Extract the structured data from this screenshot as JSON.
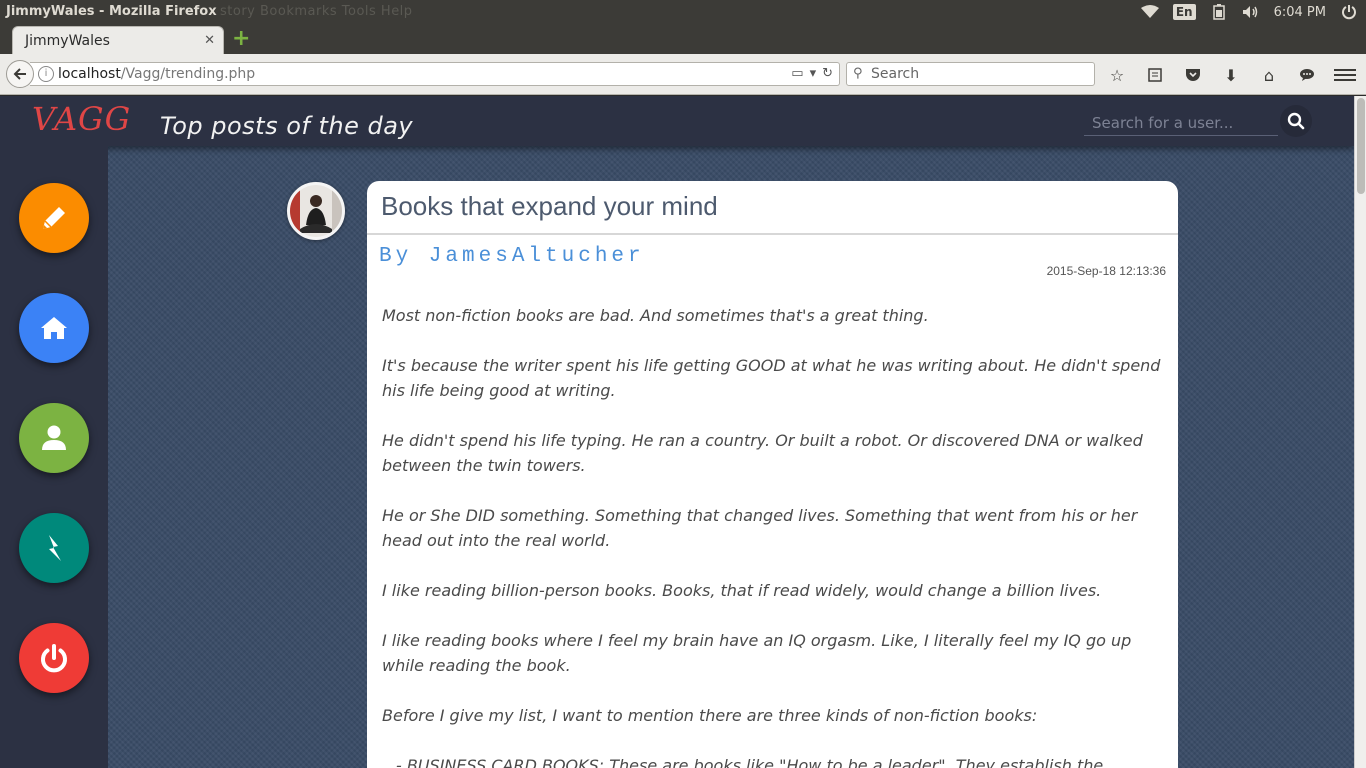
{
  "os": {
    "window_title": "JimmyWales - Mozilla Firefox",
    "ghost_menu": "story  Bookmarks  Tools  Help",
    "lang": "En",
    "clock": "6:04 PM"
  },
  "browser": {
    "tab_label": "JimmyWales",
    "url_host": "localhost",
    "url_path": "/Vagg/trending.php",
    "search_placeholder": "Search"
  },
  "app": {
    "brand": "VAGG",
    "heading": "Top posts of the day",
    "user_search_placeholder": "Search for a user...",
    "accent": "#e04646"
  },
  "sidebar": {
    "buttons": [
      {
        "name": "compose",
        "color": "#fb8c00"
      },
      {
        "name": "home",
        "color": "#3b82f6"
      },
      {
        "name": "profile",
        "color": "#7cb342"
      },
      {
        "name": "trending",
        "color": "#00897b"
      },
      {
        "name": "logout",
        "color": "#ef3b36"
      }
    ]
  },
  "post": {
    "title": "Books that expand your mind",
    "author": "By JamesAltucher",
    "date": "2015-Sep-18 12:13:36",
    "paragraphs": [
      "Most non-fiction books are bad. And sometimes that's a great thing.",
      "It's because the writer spent his life getting GOOD at what he was writing about. He didn't spend his life being good at writing.",
      "He didn't spend his life typing. He ran a country. Or built a robot. Or discovered DNA or walked between the twin towers.",
      "He or She DID something. Something that changed lives. Something that went from his or her head out into the real world.",
      "I like reading billion-person books. Books, that if read widely, would change a billion lives.",
      "I like reading books where I feel my brain have an IQ orgasm. Like, I literally feel my IQ go up while reading the book.",
      "Before I give my list, I want to mention there are three kinds of non-fiction books:",
      "- BUSINESS CARD BOOKS: These are books like \"How to be a leader\". They establish the"
    ]
  }
}
